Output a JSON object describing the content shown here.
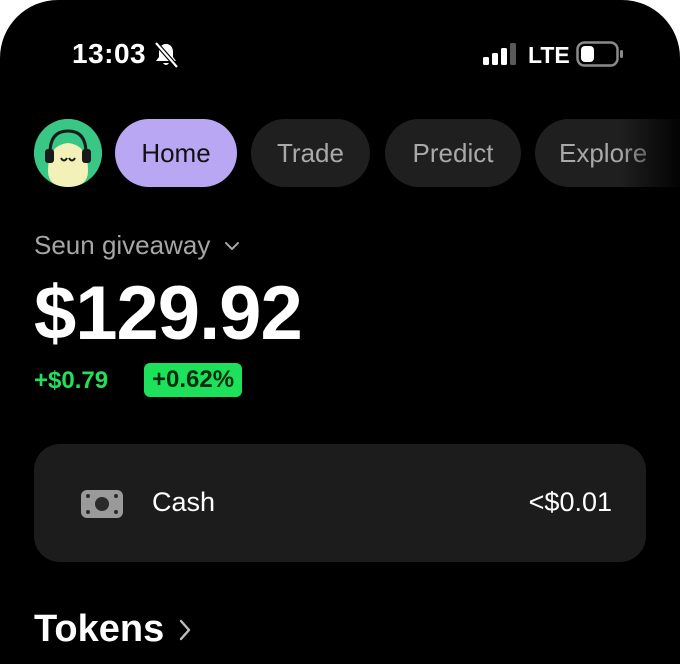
{
  "status_bar": {
    "time": "13:03",
    "network": "LTE",
    "icons": [
      "bell-slash-icon",
      "signal-bars-icon",
      "battery-icon"
    ]
  },
  "nav": {
    "avatar_icon": "avatar-icon",
    "tabs": [
      {
        "label": "Home",
        "active": true
      },
      {
        "label": "Trade",
        "active": false
      },
      {
        "label": "Predict",
        "active": false
      },
      {
        "label": "Explore",
        "active": false
      }
    ]
  },
  "account": {
    "name": "Seun giveaway",
    "balance": "$129.92",
    "change_amount": "+$0.79",
    "change_percent": "+0.62%"
  },
  "cash": {
    "icon": "cash-icon",
    "label": "Cash",
    "value": "<$0.01"
  },
  "tokens": {
    "title": "Tokens"
  },
  "colors": {
    "background": "#000000",
    "active_tab": "#b9a7f4",
    "inactive_tab": "#1f1f1f",
    "positive": "#22e05a",
    "card": "#1c1c1c",
    "avatar": "#39c785"
  }
}
